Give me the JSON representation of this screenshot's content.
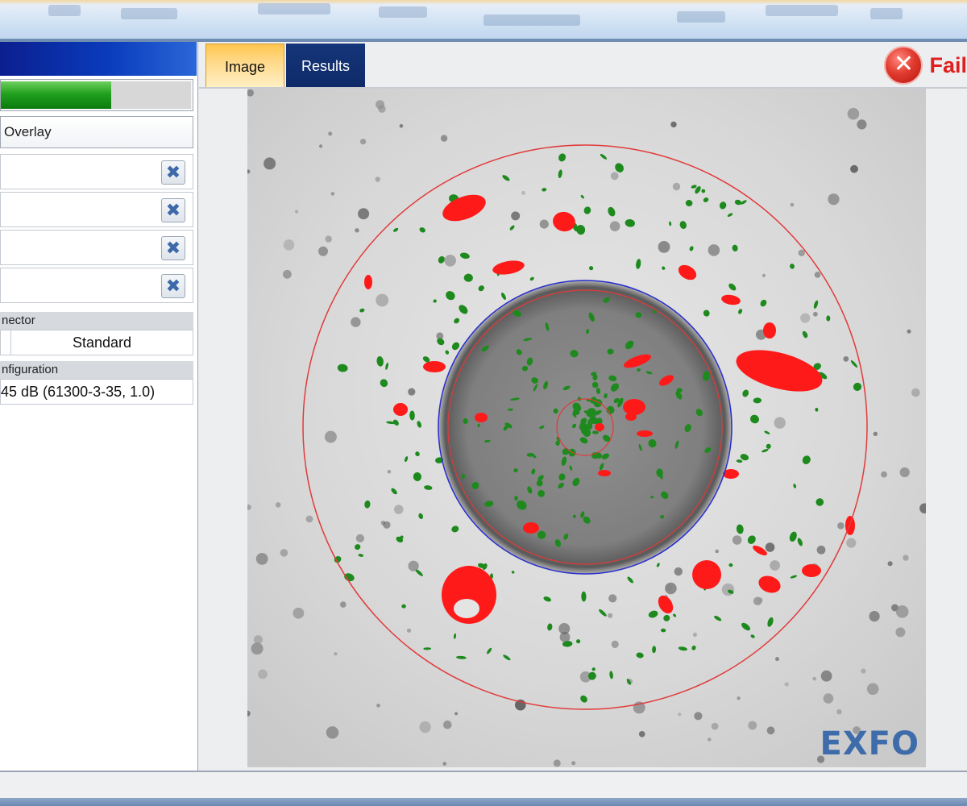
{
  "left_panel": {
    "progress": 0.58,
    "overlay_label": "Overlay",
    "list_items": [
      {
        "close_icon": "close-x-icon"
      },
      {
        "close_icon": "close-x-icon"
      },
      {
        "close_icon": "close-x-icon"
      },
      {
        "close_icon": "close-x-icon"
      }
    ],
    "connector_header": "nector",
    "connector_value": "Standard",
    "configuration_header": "nfiguration",
    "configuration_value": "45 dB (61300-3-35, 1.0)"
  },
  "tabs": [
    {
      "label": "Image",
      "active": true
    },
    {
      "label": "Results",
      "active": false
    }
  ],
  "status": {
    "icon": "fail-x-icon",
    "label": "Fail",
    "color": "#e02020"
  },
  "image": {
    "logo": "EXFO",
    "colors": {
      "defect": "#ff1a1a",
      "scratch": "#1e8a1e",
      "zone_outer": "#e23a3a",
      "cladding": "#2a2fd0"
    }
  }
}
